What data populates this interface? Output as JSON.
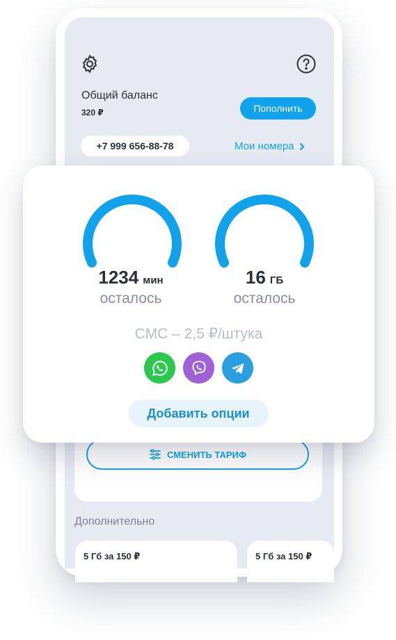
{
  "header": {
    "settings_icon": "gear-icon",
    "help_icon": "question-circle-icon"
  },
  "balance": {
    "label": "Общий баланс",
    "value": "320 ₽",
    "topup_label": "Пополнить"
  },
  "phone": {
    "number": "+7 999 656-88-78",
    "my_numbers_label": "Мои номера",
    "my_numbers_icon": "chevron-right-icon"
  },
  "usage": {
    "minutes": {
      "value": "1234",
      "unit": "мин",
      "label": "осталось"
    },
    "data": {
      "value": "16",
      "unit": "ГБ",
      "label": "осталось"
    },
    "sms": "СМС – 2,5 ₽/штука",
    "apps": [
      "whatsapp-icon",
      "viber-icon",
      "telegram-icon"
    ],
    "add_options_label": "Добавить опции"
  },
  "tariff": {
    "change_label": "СМЕНИТЬ ТАРИФ",
    "change_icon": "sliders-icon"
  },
  "extra": {
    "label": "Дополнительно",
    "offers": [
      "5 Гб за 150 ₽",
      "5 Гб за 150 ₽"
    ]
  },
  "colors": {
    "accent": "#10a3ec",
    "screen_bg": "#e6eaf2",
    "whatsapp": "#2cc84d",
    "viber": "#9e62d6",
    "telegram": "#2a9fe0"
  }
}
